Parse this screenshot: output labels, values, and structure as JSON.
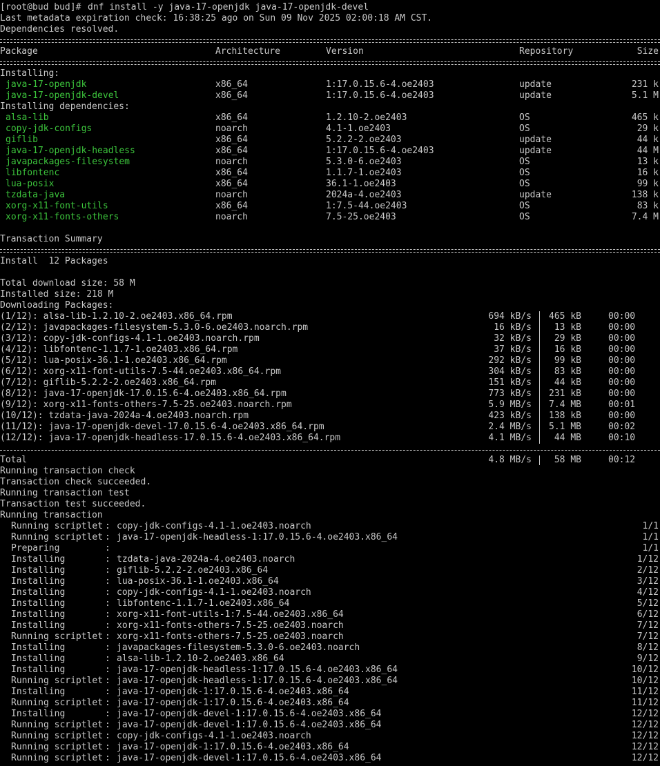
{
  "prompt_line": {
    "prompt": "[root@bud bud]#",
    "command": "dnf install -y java-17-openjdk java-17-openjdk-devel"
  },
  "metadata_line": "Last metadata expiration check: 16:38:25 ago on Sun 09 Nov 2025 02:00:18 AM CST.",
  "deps_resolved": "Dependencies resolved.",
  "table": {
    "headers": {
      "package": "Package",
      "architecture": "Architecture",
      "version": "Version",
      "repository": "Repository",
      "size": "Size"
    },
    "installing_label": "Installing:",
    "installing": [
      {
        "name": "java-17-openjdk",
        "arch": "x86_64",
        "version": "1:17.0.15.6-4.oe2403",
        "repo": "update",
        "size": "231 k"
      },
      {
        "name": "java-17-openjdk-devel",
        "arch": "x86_64",
        "version": "1:17.0.15.6-4.oe2403",
        "repo": "update",
        "size": "5.1 M"
      }
    ],
    "deps_label": "Installing dependencies:",
    "dependencies": [
      {
        "name": "alsa-lib",
        "arch": "x86_64",
        "version": "1.2.10-2.oe2403",
        "repo": "OS",
        "size": "465 k"
      },
      {
        "name": "copy-jdk-configs",
        "arch": "noarch",
        "version": "4.1-1.oe2403",
        "repo": "OS",
        "size": "29 k"
      },
      {
        "name": "giflib",
        "arch": "x86_64",
        "version": "5.2.2-2.oe2403",
        "repo": "update",
        "size": "44 k"
      },
      {
        "name": "java-17-openjdk-headless",
        "arch": "x86_64",
        "version": "1:17.0.15.6-4.oe2403",
        "repo": "update",
        "size": "44 M"
      },
      {
        "name": "javapackages-filesystem",
        "arch": "noarch",
        "version": "5.3.0-6.oe2403",
        "repo": "OS",
        "size": "13 k"
      },
      {
        "name": "libfontenc",
        "arch": "x86_64",
        "version": "1.1.7-1.oe2403",
        "repo": "OS",
        "size": "16 k"
      },
      {
        "name": "lua-posix",
        "arch": "x86_64",
        "version": "36.1-1.oe2403",
        "repo": "OS",
        "size": "99 k"
      },
      {
        "name": "tzdata-java",
        "arch": "noarch",
        "version": "2024a-4.oe2403",
        "repo": "update",
        "size": "138 k"
      },
      {
        "name": "xorg-x11-font-utils",
        "arch": "x86_64",
        "version": "1:7.5-44.oe2403",
        "repo": "OS",
        "size": "83 k"
      },
      {
        "name": "xorg-x11-fonts-others",
        "arch": "noarch",
        "version": "7.5-25.oe2403",
        "repo": "OS",
        "size": "7.4 M"
      }
    ]
  },
  "summary": {
    "title": "Transaction Summary",
    "install_count": "Install  12 Packages",
    "total_download": "Total download size: 58 M",
    "installed_size": "Installed size: 218 M",
    "downloading": "Downloading Packages:"
  },
  "downloads": [
    {
      "file": "(1/12): alsa-lib-1.2.10-2.oe2403.x86_64.rpm",
      "speed": "694 kB/s",
      "size": "465 kB",
      "time": "00:00"
    },
    {
      "file": "(2/12): javapackages-filesystem-5.3.0-6.oe2403.noarch.rpm",
      "speed": "16 kB/s",
      "size": "13 kB",
      "time": "00:00"
    },
    {
      "file": "(3/12): copy-jdk-configs-4.1-1.oe2403.noarch.rpm",
      "speed": "32 kB/s",
      "size": "29 kB",
      "time": "00:00"
    },
    {
      "file": "(4/12): libfontenc-1.1.7-1.oe2403.x86_64.rpm",
      "speed": "37 kB/s",
      "size": "16 kB",
      "time": "00:00"
    },
    {
      "file": "(5/12): lua-posix-36.1-1.oe2403.x86_64.rpm",
      "speed": "292 kB/s",
      "size": "99 kB",
      "time": "00:00"
    },
    {
      "file": "(6/12): xorg-x11-font-utils-7.5-44.oe2403.x86_64.rpm",
      "speed": "304 kB/s",
      "size": "83 kB",
      "time": "00:00"
    },
    {
      "file": "(7/12): giflib-5.2.2-2.oe2403.x86_64.rpm",
      "speed": "151 kB/s",
      "size": "44 kB",
      "time": "00:00"
    },
    {
      "file": "(8/12): java-17-openjdk-17.0.15.6-4.oe2403.x86_64.rpm",
      "speed": "773 kB/s",
      "size": "231 kB",
      "time": "00:00"
    },
    {
      "file": "(9/12): xorg-x11-fonts-others-7.5-25.oe2403.noarch.rpm",
      "speed": "5.9 MB/s",
      "size": "7.4 MB",
      "time": "00:01"
    },
    {
      "file": "(10/12): tzdata-java-2024a-4.oe2403.noarch.rpm",
      "speed": "423 kB/s",
      "size": "138 kB",
      "time": "00:00"
    },
    {
      "file": "(11/12): java-17-openjdk-devel-17.0.15.6-4.oe2403.x86_64.rpm",
      "speed": "2.4 MB/s",
      "size": "5.1 MB",
      "time": "00:02"
    },
    {
      "file": "(12/12): java-17-openjdk-headless-17.0.15.6-4.oe2403.x86_64.rpm",
      "speed": "4.1 MB/s",
      "size": "44 MB",
      "time": "00:10"
    }
  ],
  "total": {
    "label": "Total",
    "speed": "4.8 MB/s",
    "size": "58 MB",
    "time": "00:12"
  },
  "status_lines": [
    "Running transaction check",
    "Transaction check succeeded.",
    "Running transaction test",
    "Transaction test succeeded.",
    "Running transaction"
  ],
  "steps": [
    {
      "action": "Running scriptlet",
      "pkg": "copy-jdk-configs-4.1-1.oe2403.noarch",
      "count": "1/1"
    },
    {
      "action": "Running scriptlet",
      "pkg": "java-17-openjdk-headless-1:17.0.15.6-4.oe2403.x86_64",
      "count": "1/1"
    },
    {
      "action": "Preparing        ",
      "pkg": "",
      "count": "1/1"
    },
    {
      "action": "Installing       ",
      "pkg": "tzdata-java-2024a-4.oe2403.noarch",
      "count": "1/12"
    },
    {
      "action": "Installing       ",
      "pkg": "giflib-5.2.2-2.oe2403.x86_64",
      "count": "2/12"
    },
    {
      "action": "Installing       ",
      "pkg": "lua-posix-36.1-1.oe2403.x86_64",
      "count": "3/12"
    },
    {
      "action": "Installing       ",
      "pkg": "copy-jdk-configs-4.1-1.oe2403.noarch",
      "count": "4/12"
    },
    {
      "action": "Installing       ",
      "pkg": "libfontenc-1.1.7-1.oe2403.x86_64",
      "count": "5/12"
    },
    {
      "action": "Installing       ",
      "pkg": "xorg-x11-font-utils-1:7.5-44.oe2403.x86_64",
      "count": "6/12"
    },
    {
      "action": "Installing       ",
      "pkg": "xorg-x11-fonts-others-7.5-25.oe2403.noarch",
      "count": "7/12"
    },
    {
      "action": "Running scriptlet",
      "pkg": "xorg-x11-fonts-others-7.5-25.oe2403.noarch",
      "count": "7/12"
    },
    {
      "action": "Installing       ",
      "pkg": "javapackages-filesystem-5.3.0-6.oe2403.noarch",
      "count": "8/12"
    },
    {
      "action": "Installing       ",
      "pkg": "alsa-lib-1.2.10-2.oe2403.x86_64",
      "count": "9/12"
    },
    {
      "action": "Installing       ",
      "pkg": "java-17-openjdk-headless-1:17.0.15.6-4.oe2403.x86_64",
      "count": "10/12"
    },
    {
      "action": "Running scriptlet",
      "pkg": "java-17-openjdk-headless-1:17.0.15.6-4.oe2403.x86_64",
      "count": "10/12"
    },
    {
      "action": "Installing       ",
      "pkg": "java-17-openjdk-1:17.0.15.6-4.oe2403.x86_64",
      "count": "11/12"
    },
    {
      "action": "Running scriptlet",
      "pkg": "java-17-openjdk-1:17.0.15.6-4.oe2403.x86_64",
      "count": "11/12"
    },
    {
      "action": "Installing       ",
      "pkg": "java-17-openjdk-devel-1:17.0.15.6-4.oe2403.x86_64",
      "count": "12/12"
    },
    {
      "action": "Running scriptlet",
      "pkg": "java-17-openjdk-devel-1:17.0.15.6-4.oe2403.x86_64",
      "count": "12/12"
    },
    {
      "action": "Running scriptlet",
      "pkg": "copy-jdk-configs-4.1-1.oe2403.noarch",
      "count": "12/12"
    },
    {
      "action": "Running scriptlet",
      "pkg": "java-17-openjdk-1:17.0.15.6-4.oe2403.x86_64",
      "count": "12/12"
    },
    {
      "action": "Running scriptlet",
      "pkg": "java-17-openjdk-devel-1:17.0.15.6-4.oe2403.x86_64",
      "count": "12/12"
    }
  ]
}
